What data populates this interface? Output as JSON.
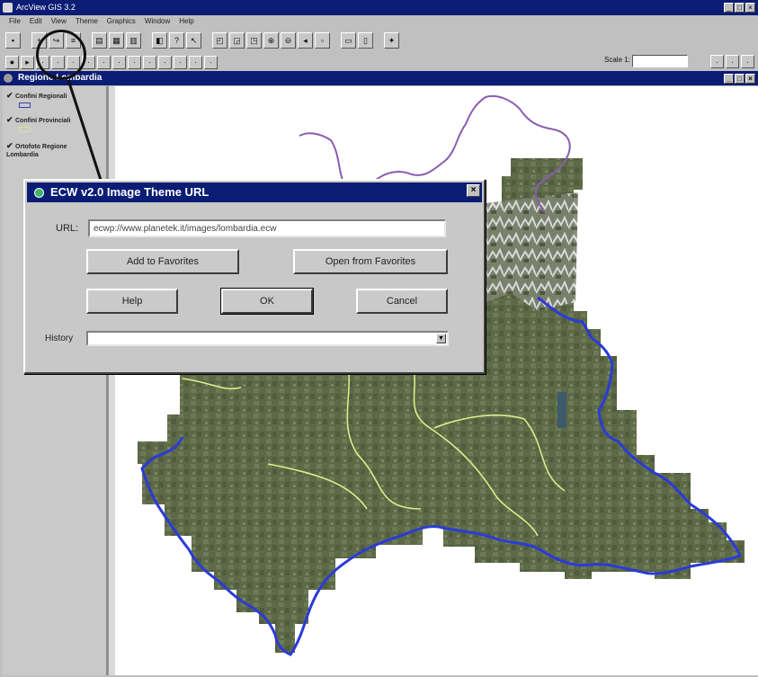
{
  "window": {
    "title": "ArcView GIS 3.2"
  },
  "menu": {
    "items": [
      "File",
      "Edit",
      "View",
      "Theme",
      "Graphics",
      "Window",
      "Help"
    ]
  },
  "toolbar": {
    "scale_label": "Scale 1:",
    "scale_value": ""
  },
  "view": {
    "title": "Regione Lombardia",
    "themes": [
      {
        "label": "Confini Regionali",
        "checked": true
      },
      {
        "label": "Confini Provinciali",
        "checked": true
      },
      {
        "label": "Ortofoto Regione Lombardia",
        "checked": true
      }
    ]
  },
  "dialog": {
    "title": "ECW v2.0 Image Theme URL",
    "url_label": "URL:",
    "url_value": "ecwp://www.planetek.it/images/lombardia.ecw",
    "add_favorites_label": "Add to Favorites",
    "open_favorites_label": "Open from Favorites",
    "help_label": "Help",
    "ok_label": "OK",
    "cancel_label": "Cancel",
    "history_label": "History",
    "history_value": ""
  },
  "colors": {
    "titlebar": "#0a1c74",
    "region_border": "#2b3bd6",
    "province_border": "#d8f08a",
    "outline_border": "#8a5cb0",
    "imagery": "#5f6b4a"
  }
}
